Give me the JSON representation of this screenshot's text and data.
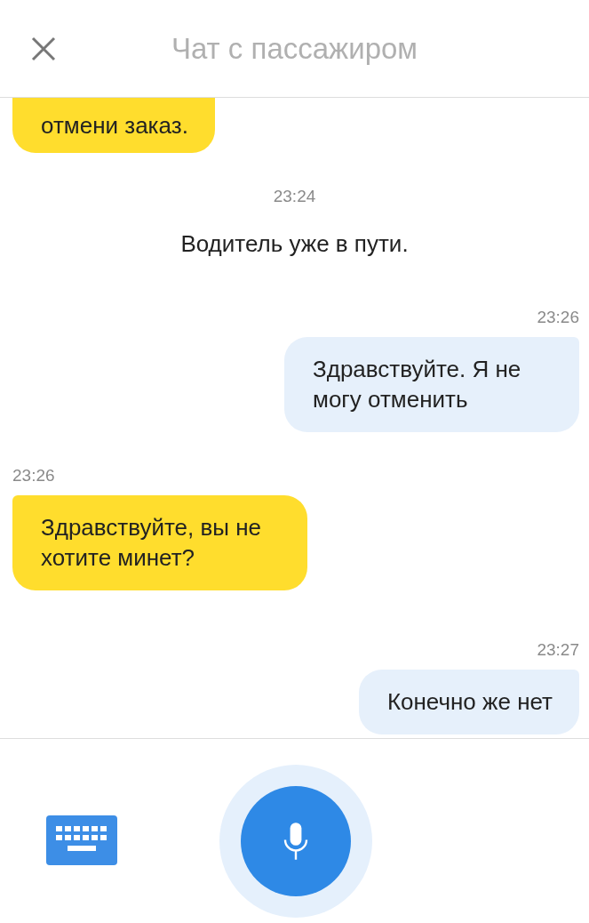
{
  "header": {
    "title": "Чат с пассажиром"
  },
  "messages": [
    {
      "kind": "incoming",
      "text": "отмени заказ.",
      "clipped": true
    },
    {
      "kind": "systemtime",
      "text": "23:24"
    },
    {
      "kind": "system",
      "text": "Водитель уже в пути."
    },
    {
      "kind": "outtime",
      "text": "23:26"
    },
    {
      "kind": "outgoing",
      "text": "Здравствуйте. Я не могу отменить",
      "clipped": false
    },
    {
      "kind": "intime",
      "text": "23:26"
    },
    {
      "kind": "incoming",
      "text": "Здравствуйте, вы не хотите минет?",
      "clipped": false
    },
    {
      "kind": "outtime",
      "text": "23:27"
    },
    {
      "kind": "outgoing",
      "text": "Конечно же нет",
      "clipped": false
    }
  ]
}
